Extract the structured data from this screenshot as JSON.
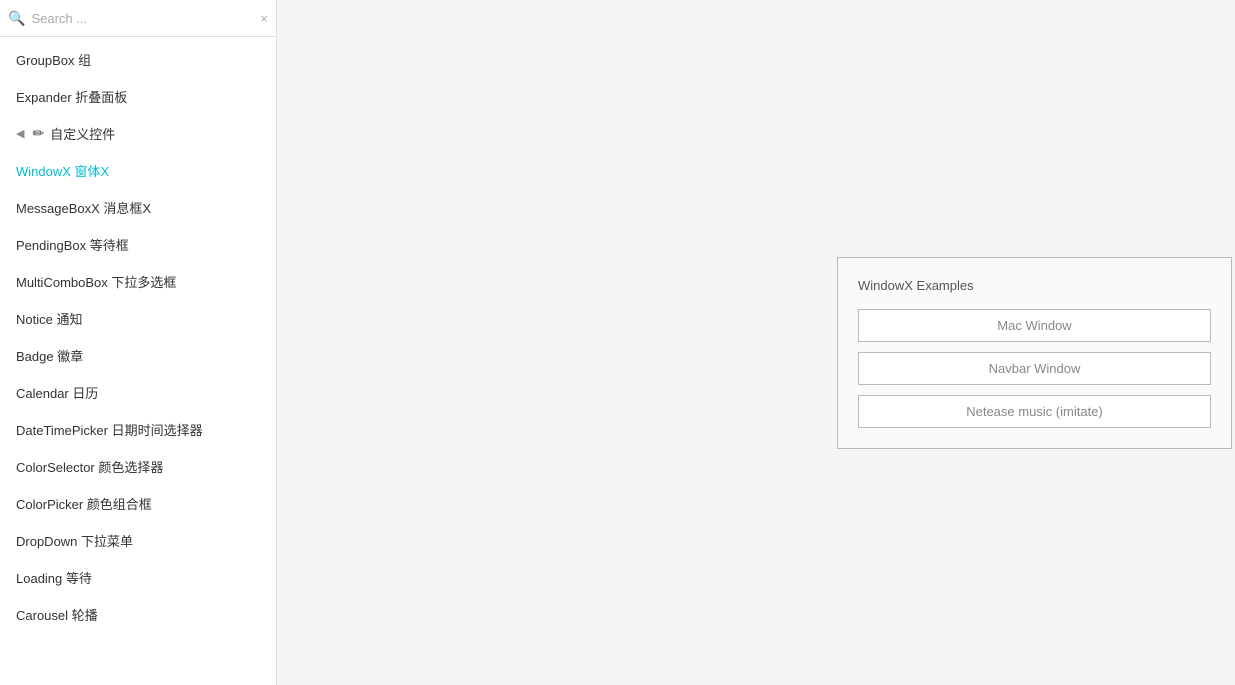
{
  "search": {
    "placeholder": "Search ...",
    "clear_label": "×"
  },
  "sidebar": {
    "items": [
      {
        "id": "groupbox",
        "label": "GroupBox 组",
        "active": false,
        "icon": null,
        "arrow": false
      },
      {
        "id": "expander",
        "label": "Expander 折叠面板",
        "active": false,
        "icon": null,
        "arrow": false
      },
      {
        "id": "custom-controls",
        "label": "自定义控件",
        "active": false,
        "icon": "✏",
        "arrow": true
      },
      {
        "id": "windowx",
        "label": "WindowX 窗体X",
        "active": true,
        "icon": null,
        "arrow": false
      },
      {
        "id": "messageboxX",
        "label": "MessageBoxX 消息框X",
        "active": false,
        "icon": null,
        "arrow": false
      },
      {
        "id": "pendingbox",
        "label": "PendingBox 等待框",
        "active": false,
        "icon": null,
        "arrow": false
      },
      {
        "id": "multicombobox",
        "label": "MultiComboBox 下拉多选框",
        "active": false,
        "icon": null,
        "arrow": false
      },
      {
        "id": "notice",
        "label": "Notice 通知",
        "active": false,
        "icon": null,
        "arrow": false
      },
      {
        "id": "badge",
        "label": "Badge 徽章",
        "active": false,
        "icon": null,
        "arrow": false
      },
      {
        "id": "calendar",
        "label": "Calendar 日历",
        "active": false,
        "icon": null,
        "arrow": false
      },
      {
        "id": "datetimepicker",
        "label": "DateTimePicker 日期时间选择器",
        "active": false,
        "icon": null,
        "arrow": false
      },
      {
        "id": "colorselector",
        "label": "ColorSelector 颜色选择器",
        "active": false,
        "icon": null,
        "arrow": false
      },
      {
        "id": "colorpicker",
        "label": "ColorPicker 颜色组合框",
        "active": false,
        "icon": null,
        "arrow": false
      },
      {
        "id": "dropdown",
        "label": "DropDown 下拉菜单",
        "active": false,
        "icon": null,
        "arrow": false
      },
      {
        "id": "loading",
        "label": "Loading 等待",
        "active": false,
        "icon": null,
        "arrow": false
      },
      {
        "id": "carousel",
        "label": "Carousel 轮播",
        "active": false,
        "icon": null,
        "arrow": false
      }
    ]
  },
  "main": {
    "windowx_examples": {
      "title": "WindowX Examples",
      "buttons": [
        {
          "id": "mac-window",
          "label": "Mac Window"
        },
        {
          "id": "navbar-window",
          "label": "Navbar Window"
        },
        {
          "id": "netease-music",
          "label": "Netease music (imitate)"
        }
      ]
    }
  }
}
